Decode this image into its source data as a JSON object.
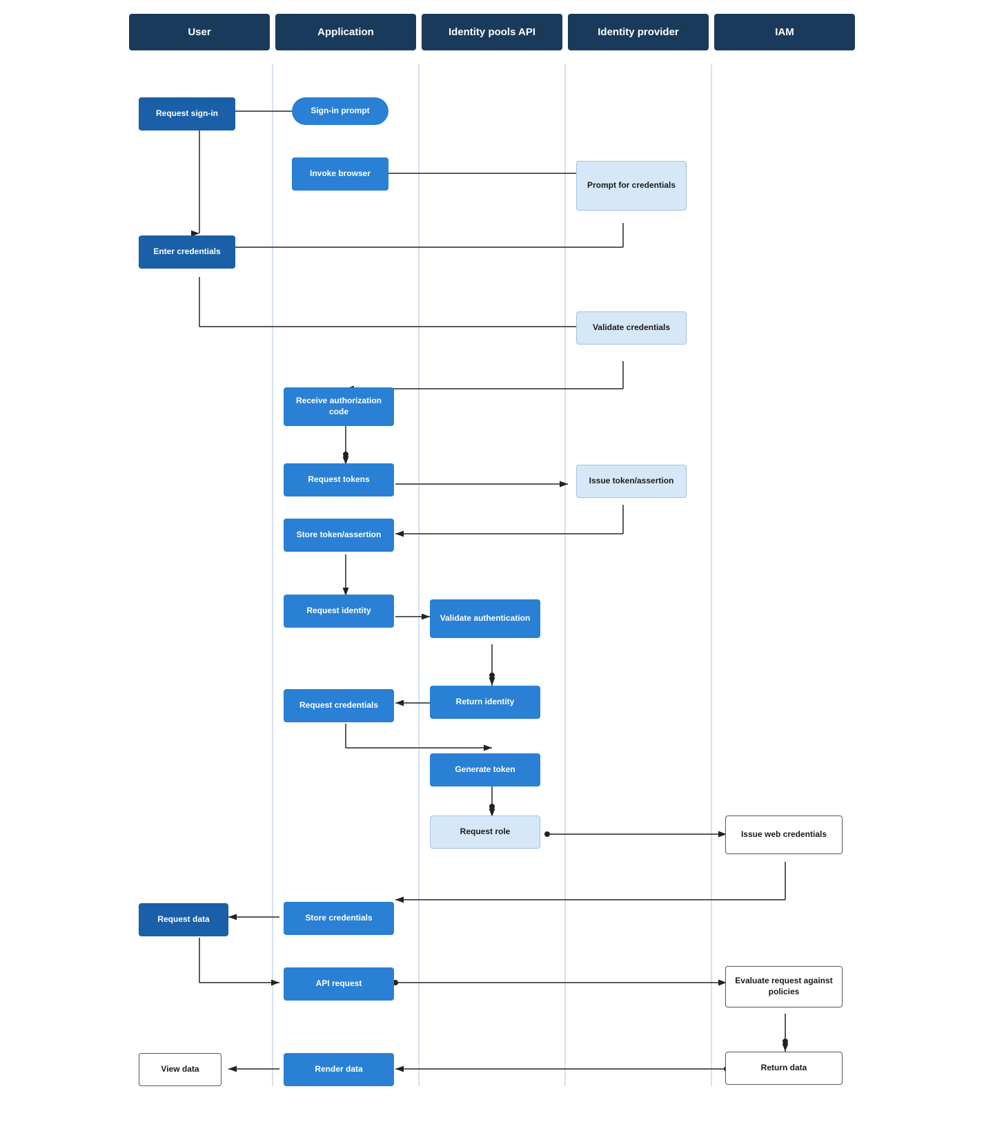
{
  "headers": {
    "col1": "User",
    "col2": "Application",
    "col3": "Identity pools API",
    "col4": "Identity provider",
    "col5": "IAM"
  },
  "nodes": {
    "request_signin": "Request sign-in",
    "sign_in_prompt": "Sign-in prompt",
    "invoke_browser": "Invoke browser",
    "prompt_credentials": "Prompt for credentials",
    "enter_credentials": "Enter credentials",
    "validate_credentials": "Validate credentials",
    "receive_auth_code": "Receive authorization code",
    "request_tokens": "Request tokens",
    "issue_token_assertion": "Issue token/assertion",
    "store_token_assertion": "Store token/assertion",
    "request_identity": "Request identity",
    "validate_authentication": "Validate authentication",
    "return_identity": "Return identity",
    "request_credentials": "Request credentials",
    "generate_token": "Generate token",
    "request_role": "Request role",
    "issue_web_credentials": "Issue web credentials",
    "store_credentials": "Store credentials",
    "request_data": "Request data",
    "api_request": "API request",
    "evaluate_request": "Evaluate request against policies",
    "render_data": "Render data",
    "return_data": "Return data",
    "view_data": "View data"
  }
}
